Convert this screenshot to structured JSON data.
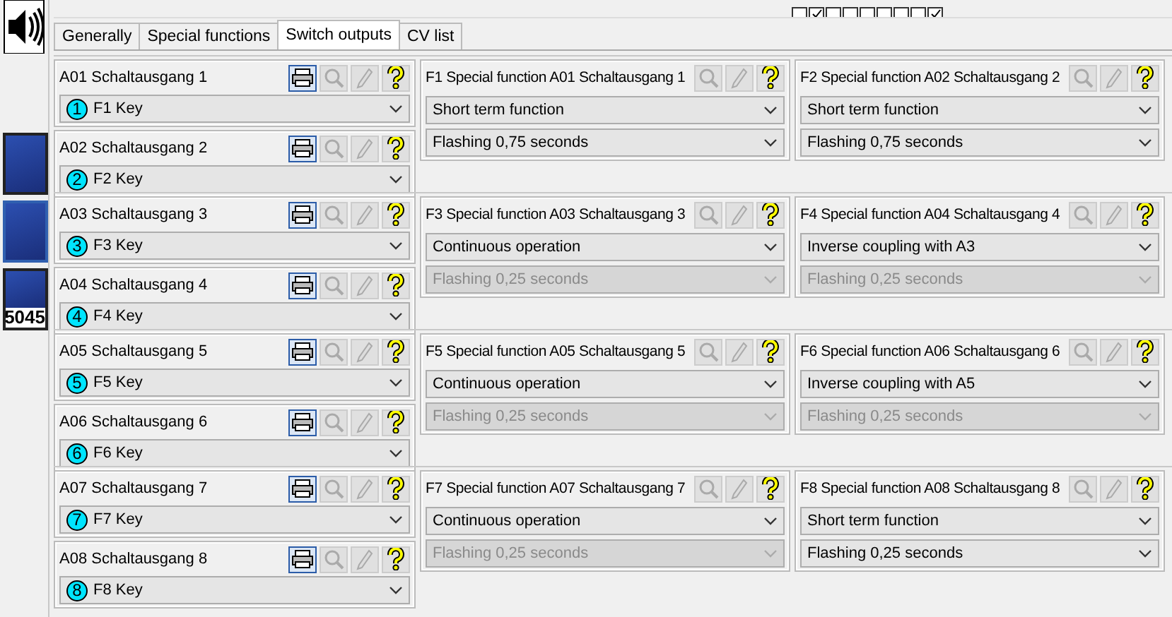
{
  "top_strip": {
    "checkboxes": [
      {
        "checked": false
      },
      {
        "checked": true
      },
      {
        "checked": false
      },
      {
        "checked": false
      },
      {
        "checked": false
      },
      {
        "checked": false
      },
      {
        "checked": false
      },
      {
        "checked": false
      },
      {
        "checked": true
      }
    ]
  },
  "sidebar": {
    "devices": [
      {
        "selected": false
      },
      {
        "selected": true
      },
      {
        "label": "5045",
        "selected": false
      }
    ]
  },
  "tabs": [
    {
      "label": "Generally",
      "selected": false
    },
    {
      "label": "Special functions",
      "selected": false
    },
    {
      "label": "Switch outputs",
      "selected": true
    },
    {
      "label": "CV list",
      "selected": false
    }
  ],
  "groups": [
    {
      "outputs": [
        {
          "title": "A01 Schaltausgang 1",
          "number": "1",
          "key": "F1 Key"
        },
        {
          "title": "A02 Schaltausgang 2",
          "number": "2",
          "key": "F2 Key"
        }
      ],
      "functions": [
        {
          "title": "F1 Special function A01 Schaltausgang 1",
          "mode": "Short term function",
          "flashing": "Flashing 0,75 seconds",
          "flashing_disabled": false
        },
        {
          "title": "F2 Special function A02 Schaltausgang 2",
          "mode": "Short term function",
          "flashing": "Flashing 0,75 seconds",
          "flashing_disabled": false
        }
      ]
    },
    {
      "outputs": [
        {
          "title": "A03 Schaltausgang 3",
          "number": "3",
          "key": "F3 Key"
        },
        {
          "title": "A04 Schaltausgang 4",
          "number": "4",
          "key": "F4 Key"
        }
      ],
      "functions": [
        {
          "title": "F3 Special function A03 Schaltausgang 3",
          "mode": "Continuous operation",
          "flashing": "Flashing 0,25 seconds",
          "flashing_disabled": true
        },
        {
          "title": "F4 Special function A04 Schaltausgang 4",
          "mode": "Inverse coupling with A3",
          "flashing": "Flashing 0,25 seconds",
          "flashing_disabled": true
        }
      ]
    },
    {
      "outputs": [
        {
          "title": "A05 Schaltausgang 5",
          "number": "5",
          "key": "F5 Key"
        },
        {
          "title": "A06 Schaltausgang 6",
          "number": "6",
          "key": "F6 Key"
        }
      ],
      "functions": [
        {
          "title": "F5 Special function A05 Schaltausgang 5",
          "mode": "Continuous operation",
          "flashing": "Flashing 0,25 seconds",
          "flashing_disabled": true
        },
        {
          "title": "F6 Special function A06 Schaltausgang 6",
          "mode": "Inverse coupling with A5",
          "flashing": "Flashing 0,25 seconds",
          "flashing_disabled": true
        }
      ]
    },
    {
      "outputs": [
        {
          "title": "A07 Schaltausgang 7",
          "number": "7",
          "key": "F7 Key"
        },
        {
          "title": "A08 Schaltausgang 8",
          "number": "8",
          "key": "F8 Key"
        }
      ],
      "functions": [
        {
          "title": "F7 Special function A07 Schaltausgang 7",
          "mode": "Continuous operation",
          "flashing": "Flashing 0,25 seconds",
          "flashing_disabled": true
        },
        {
          "title": "F8 Special function A08 Schaltausgang 8",
          "mode": "Short term function",
          "flashing": "Flashing 0,25 seconds",
          "flashing_disabled": false
        }
      ]
    }
  ]
}
